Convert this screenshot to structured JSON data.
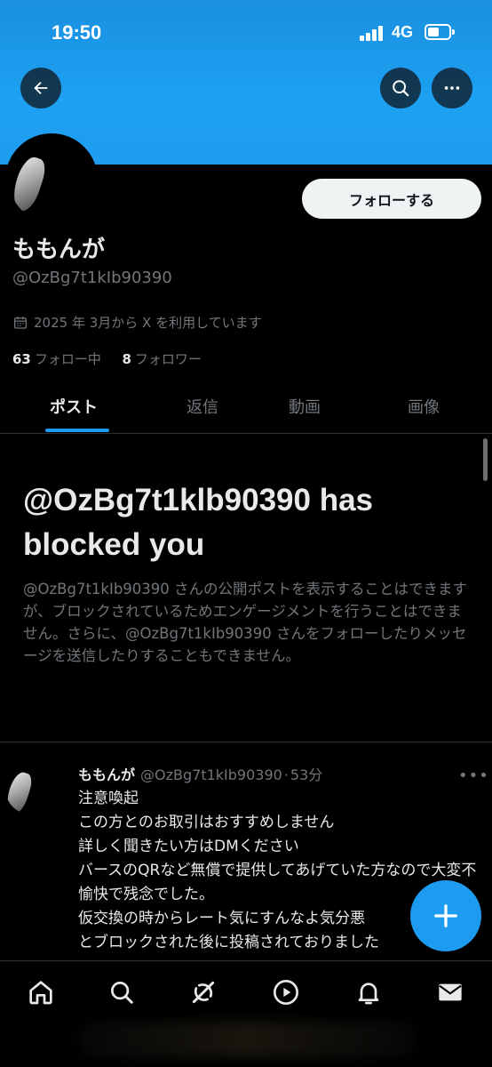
{
  "status_bar": {
    "time": "19:50",
    "network": "4G"
  },
  "profile": {
    "display_name": "ももんが",
    "handle": "@OzBg7t1kIb90390",
    "joined": "2025 年 3月から X を利用しています",
    "following_count": "63",
    "following_label": "フォロー中",
    "followers_count": "8",
    "followers_label": "フォロワー",
    "follow_button": "フォローする"
  },
  "tabs": [
    {
      "label": "ポスト",
      "active": true
    },
    {
      "label": "返信",
      "active": false
    },
    {
      "label": "動画",
      "active": false
    },
    {
      "label": "画像",
      "active": false
    }
  ],
  "blocked_notice": {
    "title": "@OzBg7t1klb90390 has blocked you",
    "body": "@OzBg7t1kIb90390 さんの公開ポストを表示することはできますが、ブロックされているためエンゲージメントを行うことはできません。さらに、@OzBg7t1kIb90390 さんをフォローしたりメッセージを送信したりすることもできません。"
  },
  "post": {
    "author": "ももんが",
    "handle": "@OzBg7t1kIb90390",
    "time": "53分",
    "lines": [
      "注意喚起",
      "この方とのお取引はおすすめしません",
      "詳しく聞きたい方はDMください",
      "バースのQRなど無償で提供してあげていた方なので大変不愉快で残念でした。",
      "仮交換の時からレート気にすんなよ気分悪",
      "とブロックされた後に投稿されておりました"
    ]
  },
  "colors": {
    "accent": "#1d9bf0",
    "banner": "#1da1f2",
    "background": "#000000",
    "muted_text": "#71767b"
  },
  "icons": {
    "back": "arrow-left-icon",
    "search": "search-icon",
    "more": "more-icon",
    "calendar": "calendar-icon",
    "fab": "plus-icon",
    "nav": [
      "home-icon",
      "search-icon",
      "grok-icon",
      "video-icon",
      "bell-icon",
      "mail-icon"
    ]
  }
}
